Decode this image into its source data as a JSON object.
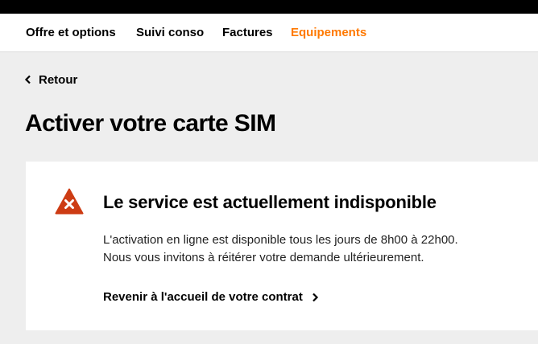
{
  "nav": {
    "items": [
      {
        "label": "Offre et options",
        "active": false
      },
      {
        "label": "Suivi conso",
        "active": false
      },
      {
        "label": "Factures",
        "active": false
      },
      {
        "label": "Equipements",
        "active": true
      }
    ],
    "active_color": "#ff7900"
  },
  "back": {
    "label": "Retour",
    "icon": "chevron-left-icon"
  },
  "page_title": "Activer votre carte SIM",
  "error_card": {
    "icon": "error-warning-icon",
    "icon_color": "#cd3c14",
    "title": "Le service est actuellement indisponible",
    "line1": "L'activation en ligne est disponible tous les jours de 8h00 à 22h00.",
    "line2": "Nous vous invitons à réitérer votre demande ultérieurement.",
    "link_label": "Revenir à l'accueil de votre contrat",
    "link_icon": "chevron-right-icon"
  }
}
